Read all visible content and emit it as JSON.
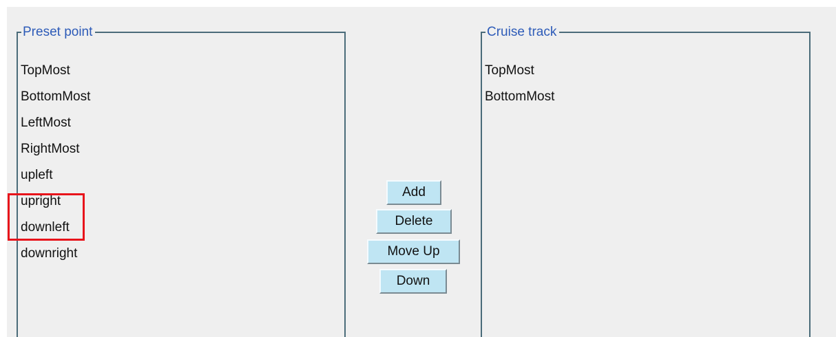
{
  "preset_panel": {
    "title": "Preset point",
    "items": [
      "TopMost",
      "BottomMost",
      "LeftMost",
      "RightMost",
      "upleft",
      "upright",
      "downleft",
      "downright"
    ]
  },
  "cruise_panel": {
    "title": "Cruise track",
    "items": [
      "TopMost",
      "BottomMost"
    ]
  },
  "buttons": {
    "add": "Add",
    "delete": "Delete",
    "move_up": "Move Up",
    "down": "Down"
  },
  "colors": {
    "legend_text": "#2d5bb8",
    "button_bg": "#bfe5f3",
    "highlight": "#e8141b",
    "border": "#4a6b79"
  }
}
